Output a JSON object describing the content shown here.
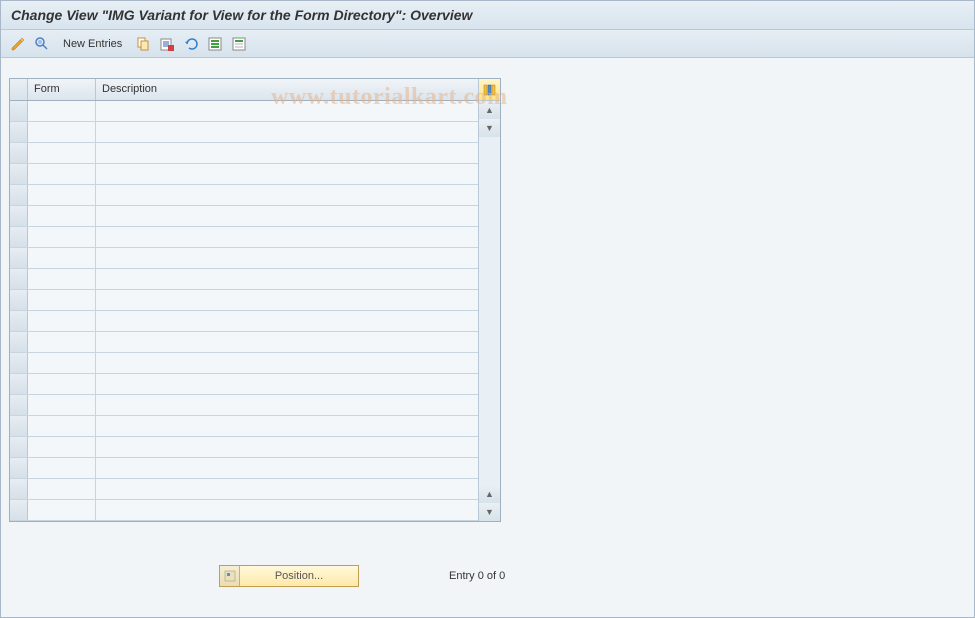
{
  "title": "Change View \"IMG Variant for View for the Form Directory\": Overview",
  "watermark": "www.tutorialkart.com",
  "toolbar": {
    "new_entries_label": "New Entries",
    "icons": {
      "toggle_change": "toggle-change-icon",
      "other_view": "other-view-icon",
      "copy": "copy-icon",
      "delete": "delete-icon",
      "undo": "undo-icon",
      "select_all": "select-all-icon",
      "deselect_all": "deselect-all-icon"
    }
  },
  "table": {
    "columns": {
      "form": "Form",
      "description": "Description"
    },
    "row_count": 20,
    "rows": []
  },
  "footer": {
    "position_label": "Position...",
    "entry_text": "Entry 0 of 0"
  }
}
